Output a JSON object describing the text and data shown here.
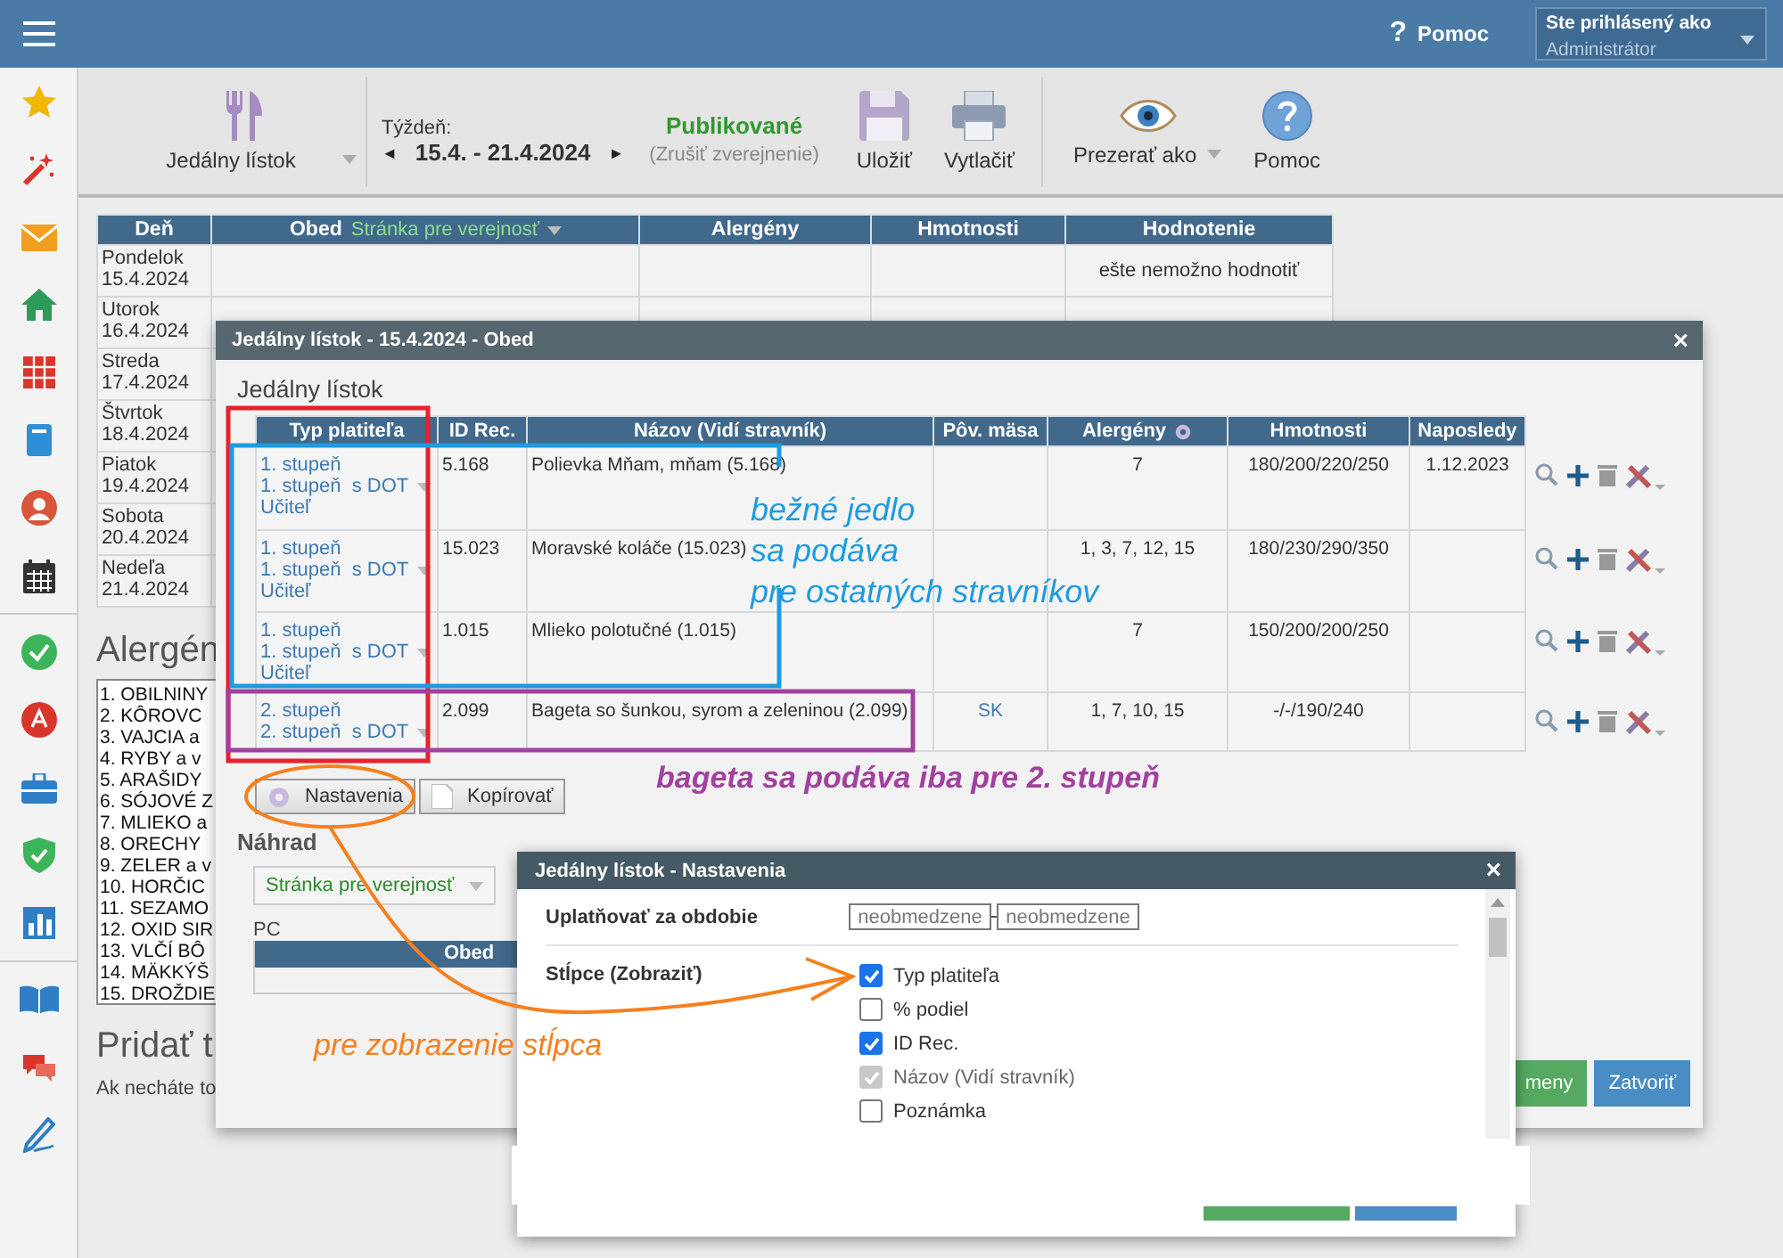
{
  "topbar": {
    "help_icon": "?",
    "help": "Pomoc",
    "user_label": "Ste prihlásený ako",
    "user": "Administrátor"
  },
  "sidebar": {
    "groups": [
      [
        {
          "kind": "star"
        },
        {
          "kind": "wand"
        },
        {
          "kind": "mail"
        },
        {
          "kind": "home"
        },
        {
          "kind": "grid"
        },
        {
          "kind": "book"
        },
        {
          "kind": "person"
        },
        {
          "kind": "calendar"
        }
      ],
      [
        {
          "kind": "check"
        },
        {
          "kind": "badge"
        },
        {
          "kind": "briefcase"
        },
        {
          "kind": "shield"
        },
        {
          "kind": "chart"
        }
      ],
      [
        {
          "kind": "reader"
        },
        {
          "kind": "chat"
        },
        {
          "kind": "pen"
        }
      ]
    ]
  },
  "toolbar": {
    "menu": "Jedálny lístok",
    "week_label": "Týždeň:",
    "prev": "◄",
    "week": "15.4. - 21.4.2024",
    "next": "►",
    "status": "Publikované",
    "status_action": "(Zrušiť zverejnenie)",
    "save": "Uložiť",
    "print": "Vytlačiť",
    "view_as": "Prezerať ako",
    "help": "Pomoc"
  },
  "week_table": {
    "columns": [
      "Deň",
      "Obed",
      "Alergény",
      "Hmotnosti",
      "Hodnotenie"
    ],
    "obed_filter": "Stránka pre verejnosť",
    "rows": [
      {
        "day": "Pondelok",
        "date": "15.4.2024",
        "rating": "ešte nemožno hodnotiť"
      },
      {
        "day": "Utorok",
        "date": "16.4.2024"
      },
      {
        "day": "Streda",
        "date": "17.4.2024"
      },
      {
        "day": "Štvrtok",
        "date": "18.4.2024"
      },
      {
        "day": "Piatok",
        "date": "19.4.2024"
      },
      {
        "day": "Sobota",
        "date": "20.4.2024"
      },
      {
        "day": "Nedeľa",
        "date": "21.4.2024"
      }
    ]
  },
  "allergens": {
    "title": "Alergén",
    "items": [
      "1. OBILNINY",
      "2. KÔROVC",
      "3. VAJCIA a",
      "4. RYBY a v",
      "5. ARAŠIDY",
      "6. SÓJOVÉ Z",
      "7. MLIEKO a",
      "8. ORECHY",
      "9. ZELER a v",
      "10. HORČIC",
      "11. SEZAMO",
      "12. OXID SIR",
      "13. VLČÍ BÔ",
      "14. MÄKKÝŠ",
      "15. DROŽDIE"
    ]
  },
  "add_section": {
    "title": "Pridať t",
    "text": "Ak necháte to"
  },
  "menu_dialog": {
    "title": "Jedálny lístok - 15.4.2024 - Obed",
    "close": "×",
    "heading": "Jedálny lístok",
    "columns": [
      "Typ platiteľa",
      "ID Rec.",
      "Názov (Vidí stravník)",
      "Pôv. mäsa",
      "Alergény",
      "Hmotnosti",
      "Naposledy"
    ],
    "rows": [
      {
        "payer_types": [
          "1. stupeň",
          "1. stupeň  s DOT",
          "Učiteľ"
        ],
        "id": "5.168",
        "name": "Polievka Mňam, mňam (5.168)",
        "allergens": "7",
        "weights": "180/200/220/250",
        "last": "1.12.2023"
      },
      {
        "payer_types": [
          "1. stupeň",
          "1. stupeň  s DOT",
          "Učiteľ"
        ],
        "id": "15.023",
        "name": "Moravské koláče (15.023)",
        "allergens": "1, 3, 7, 12, 15",
        "weights": "180/230/290/350"
      },
      {
        "payer_types": [
          "1. stupeň",
          "1. stupeň  s DOT",
          "Učiteľ"
        ],
        "id": "1.015",
        "name": "Mlieko polotučné (1.015)",
        "allergens": "7",
        "weights": "150/200/200/250"
      },
      {
        "payer_types": [
          "2. stupeň",
          "2. stupeň  s DOT"
        ],
        "id": "2.099",
        "name": "Bageta so šunkou, syrom a zeleninou (2.099)",
        "origin": "SK",
        "allergens": "1, 7, 10, 15",
        "weights": "-/-/190/240"
      }
    ],
    "settings_button": "Nastavenia",
    "copy_button": "Kopírovať",
    "substitute_heading": "Náhrad",
    "substitute_filter": "Stránka pre verejnosť",
    "pc_label": "PC",
    "pc_column": "Obed",
    "buttons": [
      "meny",
      "Zatvoriť"
    ]
  },
  "settings_dialog": {
    "title": "Jedálny lístok - Nastavenia",
    "close": "×",
    "period_label": "Uplatňovať za obdobie",
    "period_fields": [
      {
        "placeholder": "neobmedzene"
      },
      {
        "placeholder": "neobmedzene"
      }
    ],
    "columns_label": "Stĺpce (Zobraziť)",
    "columns": [
      {
        "label": "Typ platiteľa",
        "checked": true,
        "disabled": false
      },
      {
        "label": "% podiel",
        "checked": false,
        "disabled": false
      },
      {
        "label": "ID Rec.",
        "checked": true,
        "disabled": false
      },
      {
        "label": "Názov (Vidí stravník)",
        "checked": true,
        "disabled": true
      },
      {
        "label": "Poznámka",
        "checked": false,
        "disabled": false
      }
    ]
  },
  "annotations": [
    {
      "kind": "box",
      "color": "#e8202a"
    },
    {
      "kind": "bracket",
      "color": "#1e9be0",
      "lines": [
        "bežné jedlo",
        "sa podáva",
        "pre ostatných stravníkov"
      ]
    },
    {
      "kind": "box",
      "color": "#a2409f",
      "lines": [
        "bageta sa podáva iba pre 2. stupeň"
      ]
    },
    {
      "kind": "ellipse-arrow",
      "color": "#f5801e",
      "lines": [
        "pre zobrazenie stĺpca"
      ]
    }
  ]
}
